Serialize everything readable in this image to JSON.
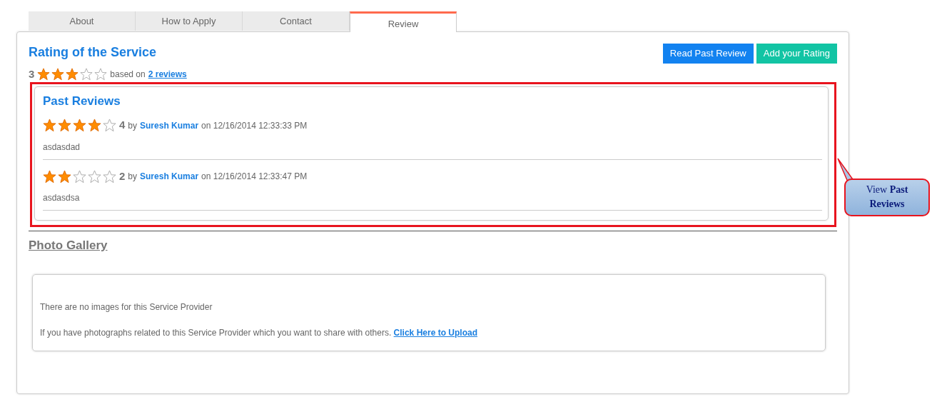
{
  "tabs": [
    {
      "label": "About",
      "selected": false
    },
    {
      "label": "How to Apply",
      "selected": false
    },
    {
      "label": "Contact",
      "selected": false
    },
    {
      "label": "Review",
      "selected": true
    }
  ],
  "rating": {
    "title": "Rating of the Service",
    "score": "3",
    "stars": 3,
    "based_on": "based on",
    "reviews_link": "2 reviews"
  },
  "buttons": [
    {
      "label": "Read Past Review",
      "kind": "primary"
    },
    {
      "label": "Add your Rating",
      "kind": "secondary"
    }
  ],
  "past_reviews": {
    "title": "Past Reviews",
    "items": [
      {
        "stars": 4,
        "score": "4",
        "by": "by",
        "author": "Suresh Kumar",
        "date": "on 12/16/2014 12:33:33 PM",
        "comment": "asdasdad"
      },
      {
        "stars": 2,
        "score": "2",
        "by": "by",
        "author": "Suresh Kumar",
        "date": "on 12/16/2014 12:33:47 PM",
        "comment": "asdasdsa"
      }
    ]
  },
  "gallery": {
    "title": "Photo Gallery",
    "empty_text": "There are no images for this Service Provider",
    "upload_text": "If you have photographs related to this Service Provider which you want to share with others.",
    "upload_link": "Click Here to Upload"
  },
  "callout": {
    "text": "View **Past Reviews**"
  }
}
